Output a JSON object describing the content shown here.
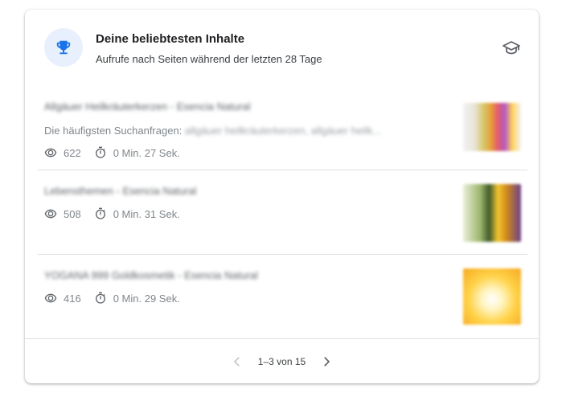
{
  "card": {
    "title": "Deine beliebtesten Inhalte",
    "subtitle": "Aufrufe nach Seiten während der letzten 28 Tage",
    "header_icon": "trophy-icon",
    "action_icon": "school-cap-icon",
    "accent_color": "#1a73e8",
    "accent_bg": "#e8f0fe"
  },
  "items": [
    {
      "title": "Allgäuer Heilkräuterkerzen - Esencia Natural",
      "query_label": "Die häufigsten Suchanfragen:",
      "query_value": "allgäuer heilkräuterkerzen, allgäuer heilk...",
      "views": "622",
      "duration": "0 Min. 27 Sek."
    },
    {
      "title": "Lebensthemen - Esencia Natural",
      "views": "508",
      "duration": "0 Min. 31 Sek."
    },
    {
      "title": "YOGANA 999 Goldkosmetik - Esencia Natural",
      "views": "416",
      "duration": "0 Min. 29 Sek."
    }
  ],
  "pagination": {
    "label": "1–3 von 15"
  }
}
